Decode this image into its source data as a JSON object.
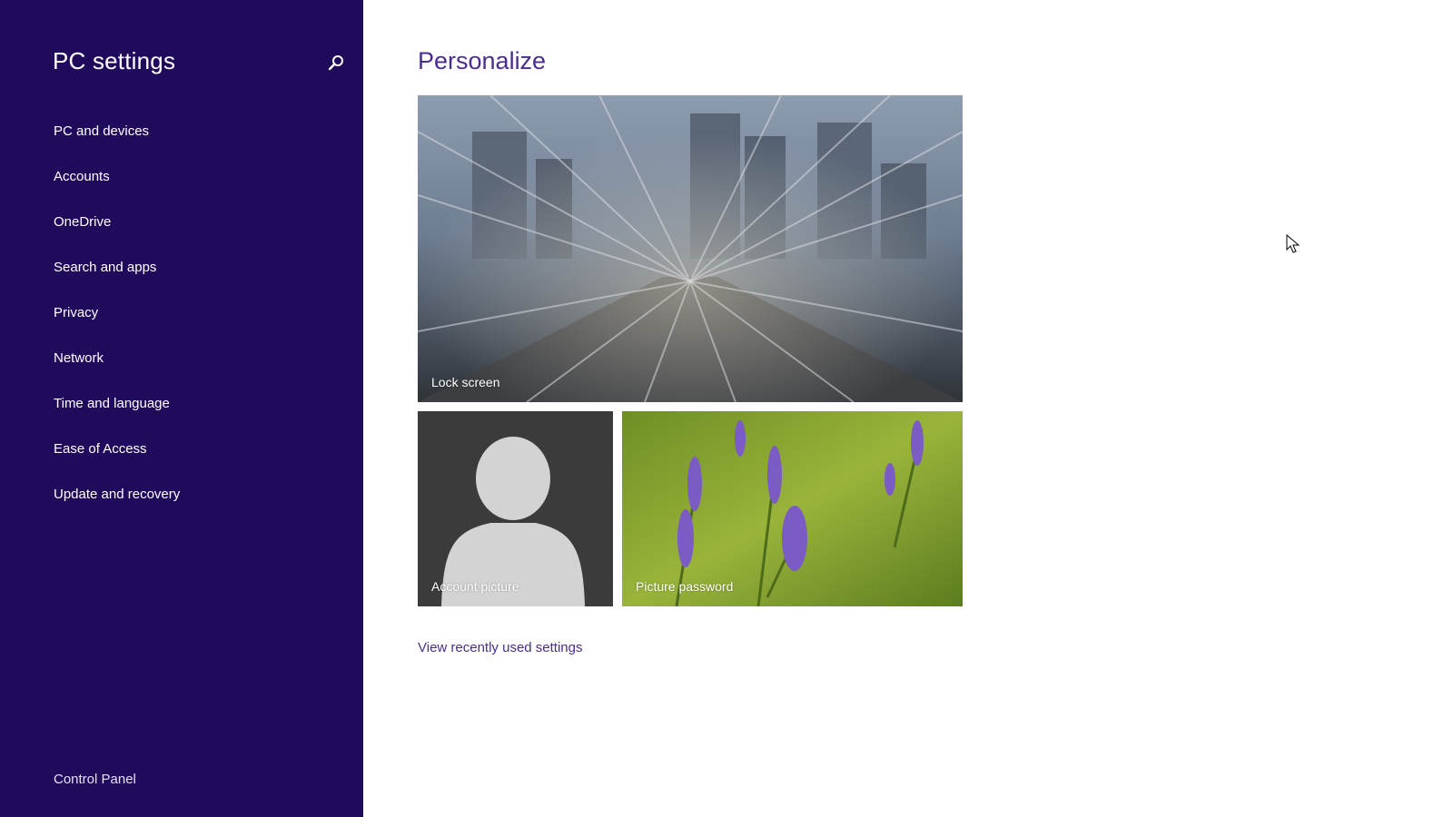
{
  "sidebar": {
    "title": "PC settings",
    "search_icon": "search-icon",
    "background_color": "#1f0a5c",
    "items": [
      {
        "label": "PC and devices"
      },
      {
        "label": "Accounts"
      },
      {
        "label": "OneDrive"
      },
      {
        "label": "Search and apps"
      },
      {
        "label": "Privacy"
      },
      {
        "label": "Network"
      },
      {
        "label": "Time and language"
      },
      {
        "label": "Ease of Access"
      },
      {
        "label": "Update and recovery"
      }
    ],
    "footer_link": "Control Panel"
  },
  "main": {
    "title": "Personalize",
    "accent_color": "#4b2d91",
    "tiles": {
      "lock_screen": {
        "label": "Lock screen"
      },
      "account_picture": {
        "label": "Account picture"
      },
      "picture_password": {
        "label": "Picture password"
      }
    },
    "recent_link": "View recently used settings"
  }
}
